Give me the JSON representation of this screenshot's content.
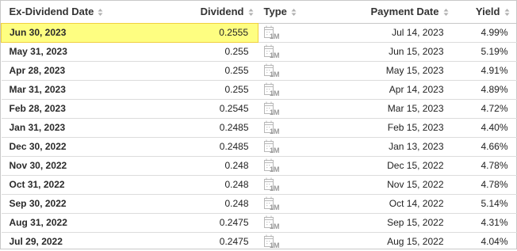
{
  "table": {
    "headers": {
      "ex_date": "Ex-Dividend Date",
      "dividend": "Dividend",
      "type": "Type",
      "payment_date": "Payment Date",
      "yield": "Yield"
    },
    "sort_icon": "sort-updown-icon",
    "frequency_icon": "calendar-1m-icon",
    "frequency_label": "1M",
    "highlight_color": "#fefe81",
    "rows": [
      {
        "ex_date": "Jun 30, 2023",
        "dividend": "0.2555",
        "payment_date": "Jul 14, 2023",
        "yield": "4.99%"
      },
      {
        "ex_date": "May 31, 2023",
        "dividend": "0.255",
        "payment_date": "Jun 15, 2023",
        "yield": "5.19%"
      },
      {
        "ex_date": "Apr 28, 2023",
        "dividend": "0.255",
        "payment_date": "May 15, 2023",
        "yield": "4.91%"
      },
      {
        "ex_date": "Mar 31, 2023",
        "dividend": "0.255",
        "payment_date": "Apr 14, 2023",
        "yield": "4.89%"
      },
      {
        "ex_date": "Feb 28, 2023",
        "dividend": "0.2545",
        "payment_date": "Mar 15, 2023",
        "yield": "4.72%"
      },
      {
        "ex_date": "Jan 31, 2023",
        "dividend": "0.2485",
        "payment_date": "Feb 15, 2023",
        "yield": "4.40%"
      },
      {
        "ex_date": "Dec 30, 2022",
        "dividend": "0.2485",
        "payment_date": "Jan 13, 2023",
        "yield": "4.66%"
      },
      {
        "ex_date": "Nov 30, 2022",
        "dividend": "0.248",
        "payment_date": "Dec 15, 2022",
        "yield": "4.78%"
      },
      {
        "ex_date": "Oct 31, 2022",
        "dividend": "0.248",
        "payment_date": "Nov 15, 2022",
        "yield": "4.78%"
      },
      {
        "ex_date": "Sep 30, 2022",
        "dividend": "0.248",
        "payment_date": "Oct 14, 2022",
        "yield": "5.14%"
      },
      {
        "ex_date": "Aug 31, 2022",
        "dividend": "0.2475",
        "payment_date": "Sep 15, 2022",
        "yield": "4.31%"
      },
      {
        "ex_date": "Jul 29, 2022",
        "dividend": "0.2475",
        "payment_date": "Aug 15, 2022",
        "yield": "4.04%"
      }
    ]
  }
}
